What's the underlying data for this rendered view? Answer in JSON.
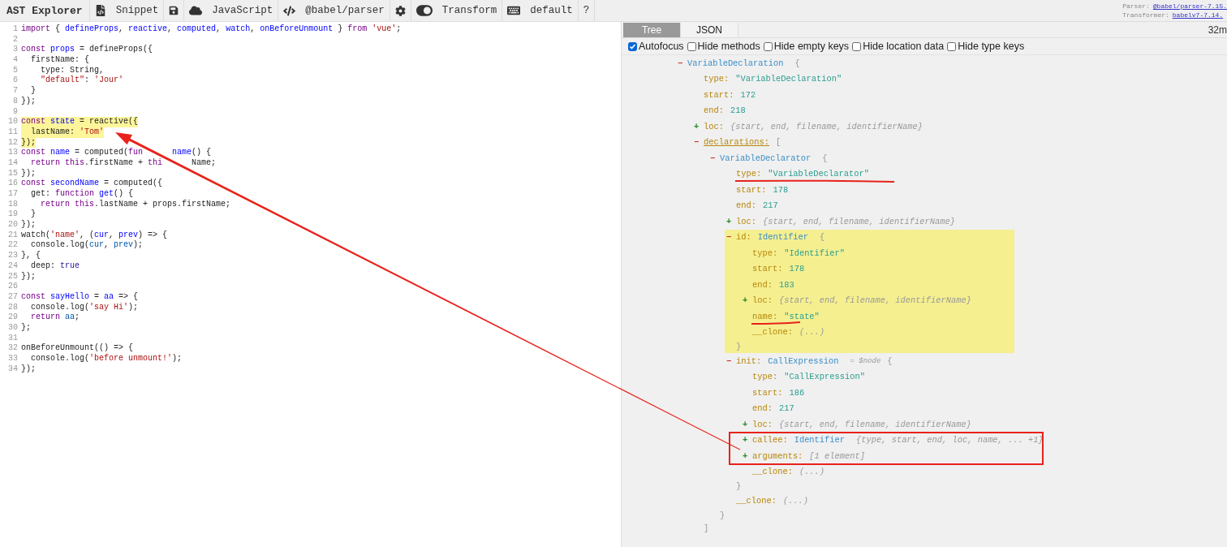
{
  "toolbar": {
    "title": "AST Explorer",
    "items": [
      {
        "kind": "snippet",
        "label": "Snippet"
      },
      {
        "kind": "save"
      },
      {
        "kind": "language",
        "label": "JavaScript"
      },
      {
        "kind": "parser",
        "label": "@babel/parser"
      },
      {
        "kind": "settings"
      },
      {
        "kind": "transform",
        "label": "Transform",
        "on": true
      },
      {
        "kind": "keymap",
        "label": "default"
      },
      {
        "kind": "help",
        "label": "?"
      }
    ],
    "versions": [
      {
        "label": "Parser:",
        "link": "@babel/parser-7.15."
      },
      {
        "label": "Transformer:",
        "link": "babelv7-7.14."
      }
    ]
  },
  "editor": {
    "lines": [
      {
        "number": "1",
        "tokens": [
          {
            "kind": "kw",
            "text": "import"
          },
          {
            "kind": "plain",
            "text": " { "
          },
          {
            "kind": "def",
            "text": "defineProps"
          },
          {
            "kind": "plain",
            "text": ", "
          },
          {
            "kind": "def",
            "text": "reactive"
          },
          {
            "kind": "plain",
            "text": ", "
          },
          {
            "kind": "def",
            "text": "computed"
          },
          {
            "kind": "plain",
            "text": ", "
          },
          {
            "kind": "def",
            "text": "watch"
          },
          {
            "kind": "plain",
            "text": ", "
          },
          {
            "kind": "def",
            "text": "onBeforeUnmount"
          },
          {
            "kind": "plain",
            "text": " } "
          },
          {
            "kind": "kw",
            "text": "from"
          },
          {
            "kind": "str",
            "text": " 'vue'"
          },
          {
            "kind": "plain",
            "text": ";"
          }
        ]
      },
      {
        "number": "2"
      },
      {
        "number": "3",
        "tokens": [
          {
            "kind": "kw",
            "text": "const"
          },
          {
            "kind": "def",
            "text": " props"
          },
          {
            "kind": "plain",
            "text": " = defineProps({"
          }
        ]
      },
      {
        "number": "4",
        "tokens": [
          {
            "kind": "plain",
            "text": "  firstName: {"
          }
        ]
      },
      {
        "number": "5",
        "tokens": [
          {
            "kind": "plain",
            "text": "    type: String,"
          }
        ]
      },
      {
        "number": "6",
        "tokens": [
          {
            "kind": "str",
            "text": "    \"default\""
          },
          {
            "kind": "plain",
            "text": ": "
          },
          {
            "kind": "str",
            "text": "'Jour'"
          }
        ]
      },
      {
        "number": "7",
        "tokens": [
          {
            "kind": "plain",
            "text": "  }"
          }
        ]
      },
      {
        "number": "8",
        "tokens": [
          {
            "kind": "plain",
            "text": "});"
          }
        ]
      },
      {
        "number": "9"
      },
      {
        "number": "10",
        "highlighted": true,
        "tokens": [
          {
            "kind": "kw",
            "text": "const"
          },
          {
            "kind": "def",
            "text": " state"
          },
          {
            "kind": "plain",
            "text": " = reactive({"
          }
        ]
      },
      {
        "number": "11",
        "highlighted": true,
        "tokens": [
          {
            "kind": "plain",
            "text": "  lastName: "
          },
          {
            "kind": "str",
            "text": "'Tom'"
          }
        ]
      },
      {
        "number": "12",
        "highlighted": true,
        "tokens": [
          {
            "kind": "plain",
            "text": "});"
          }
        ]
      },
      {
        "number": "13",
        "tokens": [
          {
            "kind": "kw",
            "text": "const"
          },
          {
            "kind": "def",
            "text": " name"
          },
          {
            "kind": "plain",
            "text": " = computed("
          },
          {
            "kind": "kw",
            "text": "fun"
          },
          {
            "kind": "def",
            "text": "name",
            "covered_before": true
          },
          {
            "kind": "plain",
            "text": "() {"
          }
        ]
      },
      {
        "number": "14",
        "tokens": [
          {
            "kind": "kw",
            "text": "  return this"
          },
          {
            "kind": "plain",
            "text": ".firstName + "
          },
          {
            "kind": "kw",
            "text": "thi"
          },
          {
            "kind": "plain",
            "text": "Name;",
            "covered_before": true
          }
        ]
      },
      {
        "number": "15",
        "tokens": [
          {
            "kind": "plain",
            "text": "});"
          }
        ]
      },
      {
        "number": "16",
        "tokens": [
          {
            "kind": "kw",
            "text": "const"
          },
          {
            "kind": "def",
            "text": " secondName"
          },
          {
            "kind": "plain",
            "text": " = computed({"
          }
        ]
      },
      {
        "number": "17",
        "tokens": [
          {
            "kind": "plain",
            "text": "  get: "
          },
          {
            "kind": "kw",
            "text": "function"
          },
          {
            "kind": "def",
            "text": " get"
          },
          {
            "kind": "plain",
            "text": "() {"
          }
        ]
      },
      {
        "number": "18",
        "tokens": [
          {
            "kind": "kw",
            "text": "    return this"
          },
          {
            "kind": "plain",
            "text": ".lastName + props.firstName;"
          }
        ]
      },
      {
        "number": "19",
        "tokens": [
          {
            "kind": "plain",
            "text": "  }"
          }
        ]
      },
      {
        "number": "20",
        "tokens": [
          {
            "kind": "plain",
            "text": "});"
          }
        ]
      },
      {
        "number": "21",
        "tokens": [
          {
            "kind": "plain",
            "text": "watch("
          },
          {
            "kind": "str",
            "text": "'name'"
          },
          {
            "kind": "plain",
            "text": ", ("
          },
          {
            "kind": "def",
            "text": "cur"
          },
          {
            "kind": "plain",
            "text": ", "
          },
          {
            "kind": "def",
            "text": "prev"
          },
          {
            "kind": "plain",
            "text": ") => {"
          }
        ]
      },
      {
        "number": "22",
        "tokens": [
          {
            "kind": "plain",
            "text": "  console.log("
          },
          {
            "kind": "var",
            "text": "cur"
          },
          {
            "kind": "plain",
            "text": ", "
          },
          {
            "kind": "var",
            "text": "prev"
          },
          {
            "kind": "plain",
            "text": ");"
          }
        ]
      },
      {
        "number": "23",
        "tokens": [
          {
            "kind": "plain",
            "text": "}, {"
          }
        ]
      },
      {
        "number": "24",
        "tokens": [
          {
            "kind": "plain",
            "text": "  deep: "
          },
          {
            "kind": "atom",
            "text": "true"
          }
        ]
      },
      {
        "number": "25",
        "tokens": [
          {
            "kind": "plain",
            "text": "});"
          }
        ]
      },
      {
        "number": "26"
      },
      {
        "number": "27",
        "tokens": [
          {
            "kind": "kw",
            "text": "const"
          },
          {
            "kind": "def",
            "text": " sayHello"
          },
          {
            "kind": "plain",
            "text": " = "
          },
          {
            "kind": "def",
            "text": "aa"
          },
          {
            "kind": "plain",
            "text": " => {"
          }
        ]
      },
      {
        "number": "28",
        "tokens": [
          {
            "kind": "plain",
            "text": "  console.log("
          },
          {
            "kind": "str",
            "text": "'say Hi'"
          },
          {
            "kind": "plain",
            "text": ");"
          }
        ]
      },
      {
        "number": "29",
        "tokens": [
          {
            "kind": "kw",
            "text": "  return"
          },
          {
            "kind": "var",
            "text": " aa"
          },
          {
            "kind": "plain",
            "text": ";"
          }
        ]
      },
      {
        "number": "30",
        "tokens": [
          {
            "kind": "plain",
            "text": "};"
          }
        ]
      },
      {
        "number": "31"
      },
      {
        "number": "32",
        "tokens": [
          {
            "kind": "plain",
            "text": "onBeforeUnmount(() => {"
          }
        ]
      },
      {
        "number": "33",
        "tokens": [
          {
            "kind": "plain",
            "text": "  console.log("
          },
          {
            "kind": "str",
            "text": "'before unmount!'"
          },
          {
            "kind": "plain",
            "text": ");"
          }
        ]
      },
      {
        "number": "34",
        "tokens": [
          {
            "kind": "plain",
            "text": "});"
          }
        ]
      }
    ]
  },
  "output": {
    "tabs": [
      {
        "label": "Tree",
        "selected": true
      },
      {
        "label": "JSON",
        "selected": false
      }
    ],
    "time": "32m",
    "options": [
      {
        "label": "Autofocus",
        "checked": true
      },
      {
        "label": "Hide methods",
        "checked": false
      },
      {
        "label": "Hide empty keys",
        "checked": false
      },
      {
        "label": "Hide location data",
        "checked": false
      },
      {
        "label": "Hide type keys",
        "checked": false
      }
    ],
    "tree": [
      {
        "kind": "node",
        "toggle": "−",
        "expanded": true,
        "type": "VariableDeclaration",
        "open": "{",
        "children": [
          {
            "kind": "string",
            "key": "type:",
            "value": "\"VariableDeclaration\""
          },
          {
            "kind": "number",
            "key": "start:",
            "value": "172"
          },
          {
            "kind": "number",
            "key": "end:",
            "value": "218"
          },
          {
            "kind": "node",
            "toggle": "+",
            "expanded": false,
            "key": "loc:",
            "summary": "{start, end, filename, identifierName}"
          },
          {
            "kind": "node",
            "toggle": "−",
            "expanded": true,
            "key": "declarations:",
            "hovered": true,
            "open": "[",
            "close": "]",
            "children": [
              {
                "kind": "node",
                "toggle": "−",
                "expanded": true,
                "type": "VariableDeclarator",
                "open": "{",
                "close": "}",
                "children": [
                  {
                    "kind": "string",
                    "key": "type:",
                    "value": "\"VariableDeclarator\""
                  },
                  {
                    "kind": "number",
                    "key": "start:",
                    "value": "178"
                  },
                  {
                    "kind": "number",
                    "key": "end:",
                    "value": "217"
                  },
                  {
                    "kind": "node",
                    "toggle": "+",
                    "expanded": false,
                    "key": "loc:",
                    "summary": "{start, end, filename, identifierName}"
                  },
                  {
                    "kind": "node",
                    "toggle": "−",
                    "expanded": true,
                    "key": "id:",
                    "type": "Identifier",
                    "open": "{",
                    "close": "}",
                    "highlighted": true,
                    "children": [
                      {
                        "kind": "string",
                        "key": "type:",
                        "value": "\"Identifier\""
                      },
                      {
                        "kind": "number",
                        "key": "start:",
                        "value": "178"
                      },
                      {
                        "kind": "number",
                        "key": "end:",
                        "value": "183"
                      },
                      {
                        "kind": "node",
                        "toggle": "+",
                        "expanded": false,
                        "key": "loc:",
                        "summary": "{start, end, filename, identifierName}"
                      },
                      {
                        "kind": "string",
                        "key": "name:",
                        "value": "\"state\""
                      },
                      {
                        "kind": "summary",
                        "key": "__clone:",
                        "value": "(...)"
                      }
                    ]
                  },
                  {
                    "kind": "node",
                    "toggle": "−",
                    "expanded": true,
                    "key": "init:",
                    "type": "CallExpression",
                    "note": "= $node",
                    "open": "{",
                    "close": "}",
                    "children": [
                      {
                        "kind": "string",
                        "key": "type:",
                        "value": "\"CallExpression\""
                      },
                      {
                        "kind": "number",
                        "key": "start:",
                        "value": "186"
                      },
                      {
                        "kind": "number",
                        "key": "end:",
                        "value": "217"
                      },
                      {
                        "kind": "node",
                        "toggle": "+",
                        "expanded": false,
                        "key": "loc:",
                        "summary": "{start, end, filename, identifierName}"
                      },
                      {
                        "kind": "node",
                        "toggle": "+",
                        "expanded": false,
                        "key": "callee:",
                        "type": "Identifier",
                        "summary": "{type, start, end, loc, name, ... +1}"
                      },
                      {
                        "kind": "node",
                        "toggle": "+",
                        "expanded": false,
                        "key": "arguments:",
                        "summary": "[1 element]"
                      },
                      {
                        "kind": "summary",
                        "key": "__clone:",
                        "value": "(...)"
                      }
                    ]
                  },
                  {
                    "kind": "summary",
                    "key": "__clone:",
                    "value": "(...)"
                  }
                ]
              }
            ]
          }
        ]
      }
    ]
  }
}
